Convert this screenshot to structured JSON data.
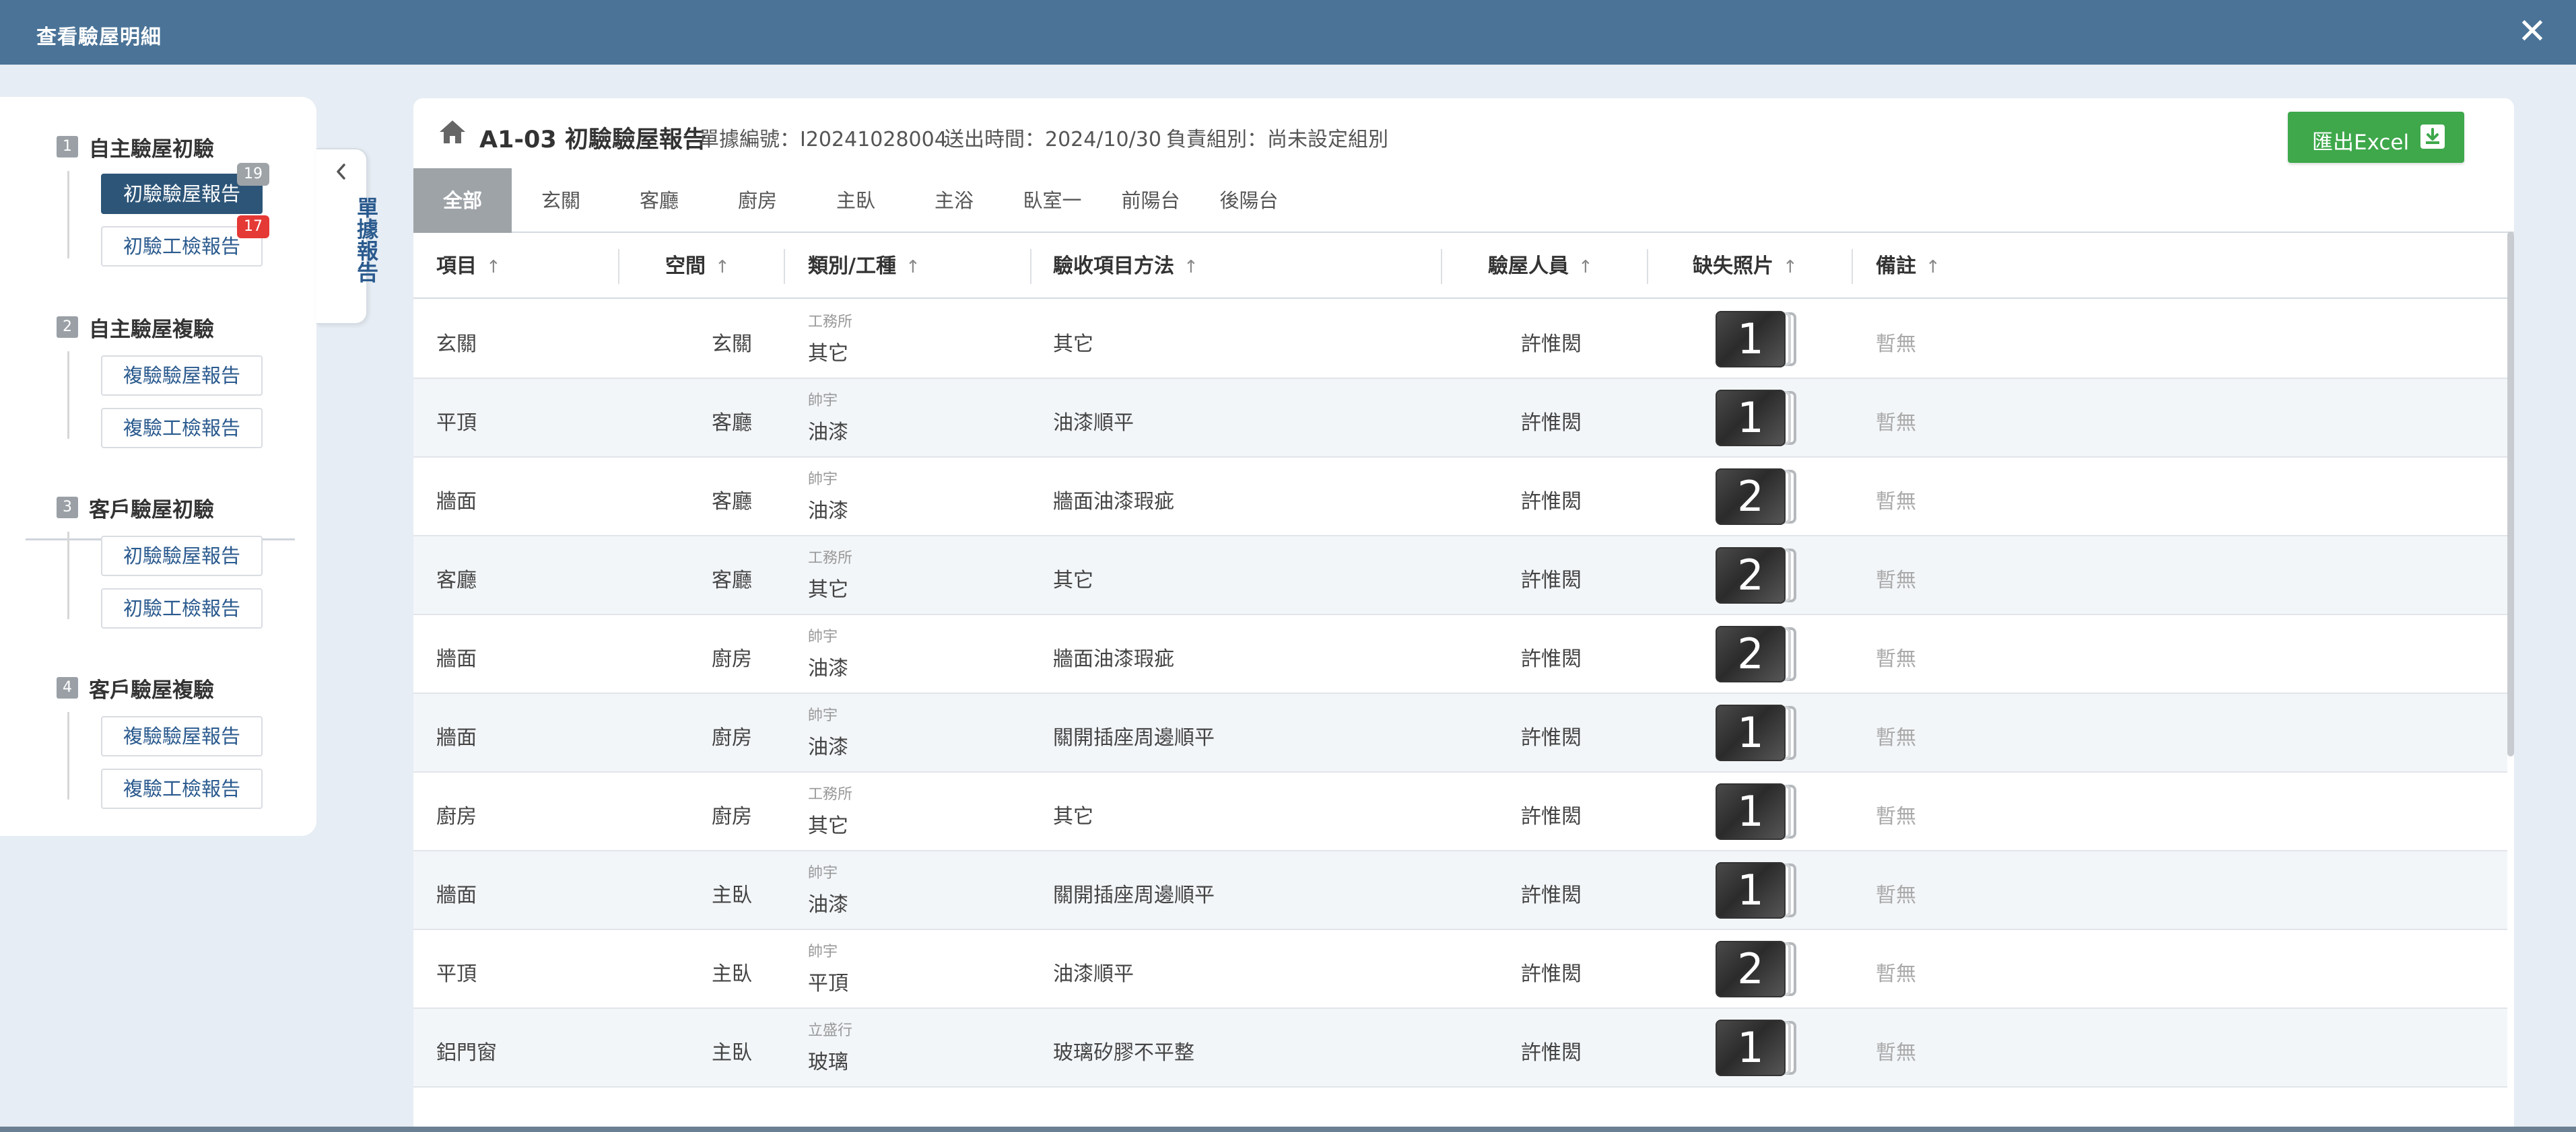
{
  "window": {
    "title": "查看驗屋明細"
  },
  "sidebar": {
    "stages": [
      {
        "num": "1",
        "name": "自主驗屋初驗",
        "reports": [
          {
            "label": "初驗驗屋報告",
            "badge": "19"
          },
          {
            "label": "初驗工檢報告",
            "badge": "17"
          }
        ]
      },
      {
        "num": "2",
        "name": "自主驗屋複驗",
        "reports": [
          {
            "label": "複驗驗屋報告"
          },
          {
            "label": "複驗工檢報告"
          }
        ]
      },
      {
        "num": "3",
        "name": "客戶驗屋初驗",
        "reports": [
          {
            "label": "初驗驗屋報告"
          },
          {
            "label": "初驗工檢報告"
          }
        ]
      },
      {
        "num": "4",
        "name": "客戶驗屋複驗",
        "reports": [
          {
            "label": "複驗驗屋報告"
          },
          {
            "label": "複驗工檢報告"
          }
        ]
      }
    ],
    "collapse_label": "單據報告"
  },
  "report": {
    "title": "A1-03 初驗驗屋報告",
    "doc_no_label": "單據編號：",
    "doc_no": "I20241028004",
    "sent_label": "送出時間：",
    "sent": "2024/10/30",
    "group_label": "負責組別：",
    "group": "尚未設定組別",
    "export_label": "匯出Excel"
  },
  "tabs": [
    "全部",
    "玄關",
    "客廳",
    "廚房",
    "主臥",
    "主浴",
    "臥室一",
    "前陽台",
    "後陽台"
  ],
  "table": {
    "headers": [
      "項目",
      "空間",
      "類別/工種",
      "驗收項目方法",
      "驗屋人員",
      "缺失照片",
      "備註"
    ],
    "rows": [
      {
        "item": "玄關",
        "space": "玄關",
        "vendor": "工務所",
        "trade": "其它",
        "method": "其它",
        "inspector": "許惟閎",
        "photos": "1",
        "remark": "暫無"
      },
      {
        "item": "平頂",
        "space": "客廳",
        "vendor": "帥宇",
        "trade": "油漆",
        "method": "油漆順平",
        "inspector": "許惟閎",
        "photos": "1",
        "remark": "暫無"
      },
      {
        "item": "牆面",
        "space": "客廳",
        "vendor": "帥宇",
        "trade": "油漆",
        "method": "牆面油漆瑕疵",
        "inspector": "許惟閎",
        "photos": "2",
        "remark": "暫無"
      },
      {
        "item": "客廳",
        "space": "客廳",
        "vendor": "工務所",
        "trade": "其它",
        "method": "其它",
        "inspector": "許惟閎",
        "photos": "2",
        "remark": "暫無"
      },
      {
        "item": "牆面",
        "space": "廚房",
        "vendor": "帥宇",
        "trade": "油漆",
        "method": "牆面油漆瑕疵",
        "inspector": "許惟閎",
        "photos": "2",
        "remark": "暫無"
      },
      {
        "item": "牆面",
        "space": "廚房",
        "vendor": "帥宇",
        "trade": "油漆",
        "method": "關開插座周邊順平",
        "inspector": "許惟閎",
        "photos": "1",
        "remark": "暫無"
      },
      {
        "item": "廚房",
        "space": "廚房",
        "vendor": "工務所",
        "trade": "其它",
        "method": "其它",
        "inspector": "許惟閎",
        "photos": "1",
        "remark": "暫無"
      },
      {
        "item": "牆面",
        "space": "主臥",
        "vendor": "帥宇",
        "trade": "油漆",
        "method": "關開插座周邊順平",
        "inspector": "許惟閎",
        "photos": "1",
        "remark": "暫無"
      },
      {
        "item": "平頂",
        "space": "主臥",
        "vendor": "帥宇",
        "trade": "平頂",
        "method": "油漆順平",
        "inspector": "許惟閎",
        "photos": "2",
        "remark": "暫無"
      },
      {
        "item": "鋁門窗",
        "space": "主臥",
        "vendor": "立盛行",
        "trade": "玻璃",
        "method": "玻璃矽膠不平整",
        "inspector": "許惟閎",
        "photos": "1",
        "remark": "暫無"
      }
    ]
  },
  "colors": {
    "titlebar": "#4a7397",
    "active_report": "#2d5578",
    "export": "#3ea84b",
    "badge_red": "#e53935",
    "active_tab": "#9ea3a8"
  }
}
